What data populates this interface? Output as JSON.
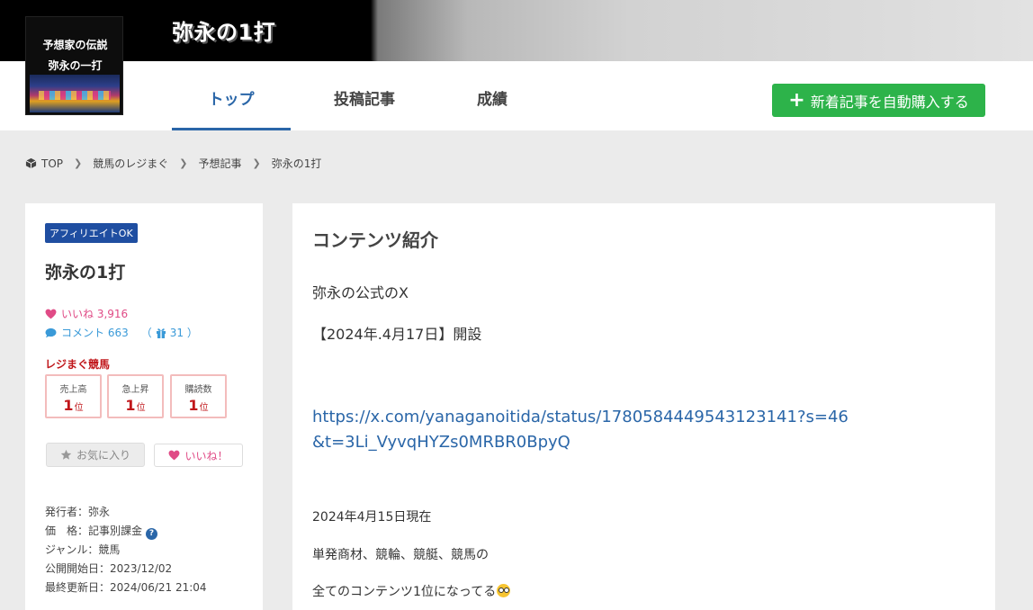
{
  "banner": {
    "title": "弥永の1打"
  },
  "logo": {
    "line1": "予想家の伝説",
    "line2": "弥永の一打"
  },
  "nav": {
    "tabs": [
      {
        "label": "トップ",
        "active": true
      },
      {
        "label": "投稿記事",
        "active": false
      },
      {
        "label": "成績",
        "active": false
      }
    ],
    "buy_button": "新着記事を自動購入する"
  },
  "breadcrumb": [
    "TOP",
    "競馬のレジまぐ",
    "予想記事",
    "弥永の1打"
  ],
  "sidebar": {
    "affiliate_badge": "アフィリエイトOK",
    "title": "弥永の1打",
    "likes_label": "いいね 3,916",
    "comments_label": "コメント 663",
    "gift_count": "31",
    "ranking_label": "レジまぐ競馬",
    "ranks": [
      {
        "label": "売上高",
        "value": "1",
        "unit": "位"
      },
      {
        "label": "急上昇",
        "value": "1",
        "unit": "位"
      },
      {
        "label": "購読数",
        "value": "1",
        "unit": "位"
      }
    ],
    "favorite_button": "お気に入り",
    "like_button": "いいね！",
    "meta": {
      "publisher": "発行者：弥永",
      "price": "価　格：記事別課金",
      "genre": "ジャンル：競馬",
      "start_date": "公開開始日：2023/12/02",
      "updated": "最終更新日：2024/06/21 21:04"
    }
  },
  "main": {
    "title": "コンテンツ紹介",
    "line1": "弥永の公式のX",
    "line2": "【2024年.4月17日】開設",
    "link": "https://x.com/yanaganoitida/status/1780584449543123141?s=46&t=3Li_VyvqHYZs0MRBR0BpyQ",
    "line3": "2024年4月15日現在",
    "line4": "単発商材、競輪、競艇、競馬の",
    "line5": "全てのコンテンツ1位になってる"
  },
  "colors": {
    "accent_blue": "#2a66a8",
    "buy_green": "#2db34a",
    "rank_red": "#c0171b",
    "like_pink": "#e04b86",
    "comment_blue": "#3a9ad8"
  }
}
